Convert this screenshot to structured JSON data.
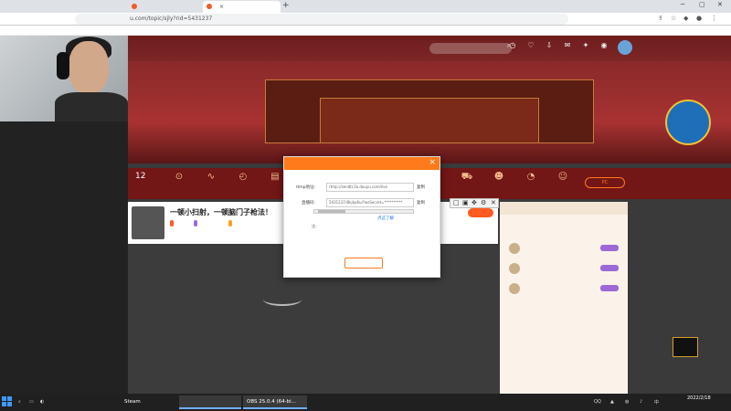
{
  "browser": {
    "tabs": [
      {
        "label": "",
        "active": false
      },
      {
        "label": "",
        "active": true
      }
    ],
    "url": "u.com/topic/sjly?rid=5431237",
    "bookmark": "",
    "new_tab": "+",
    "tab_close": "×"
  },
  "site": {
    "nav": [
      "",
      "",
      "",
      "",
      "",
      ""
    ],
    "nav_active_index": 1,
    "room_count": "12",
    "room_count_label": "",
    "pc_button": "PC",
    "follow_label": ""
  },
  "stream": {
    "title": "一顿小扫射，一顿脑门子枪法！",
    "badges": [
      {
        "text": "",
        "color": "#ff5a1f"
      },
      {
        "text": "",
        "color": "#9b6ad6"
      },
      {
        "text": "",
        "color": "#ff9f1a"
      }
    ],
    "empty_text": ""
  },
  "chat": {
    "tabs": "",
    "ranks": [
      {
        "name": ""
      },
      {
        "name": ""
      },
      {
        "name": ""
      }
    ],
    "announcement": "",
    "messages": [
      {
        "user": "",
        "text": ""
      },
      {
        "user": "",
        "text": ""
      }
    ]
  },
  "popup": {
    "title": "",
    "rtmp_label": "rtmp地址:",
    "rtmp_value": "rtmp://sendtc3a.douyu.com/live",
    "key_label": "直播码:",
    "key_value": "5431237rBkjkp6u/?wsSecret=**********",
    "copy_label": "复制",
    "warn_text": "",
    "hint_link": "点这了解",
    "notice_title": "注:",
    "notice_lines": [
      "",
      ""
    ],
    "ok_label": "",
    "close_symbol": "×"
  },
  "minibar": [
    "□",
    "▣",
    "✥",
    "⚙",
    "✕"
  ],
  "taskbar": {
    "items": [
      {
        "label": "",
        "active": false
      },
      {
        "label": "Steam",
        "active": false
      },
      {
        "label": "",
        "active": true
      },
      {
        "label": "OBS 25.0.4 (64-bi...",
        "active": true
      }
    ],
    "time": "",
    "date": "2022/2/18",
    "tray": "QQ"
  },
  "logo_text": "",
  "colors": {
    "accent": "#ff7a1a",
    "nav_bg": "#6e1d1d",
    "taskbar": "#202020"
  }
}
